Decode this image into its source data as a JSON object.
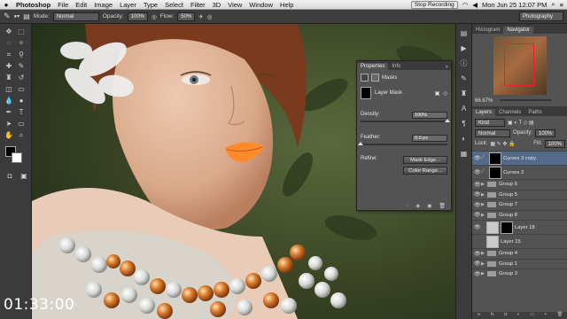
{
  "menubar": {
    "apple": "",
    "items": [
      "Photoshop",
      "File",
      "Edit",
      "Image",
      "Layer",
      "Type",
      "Select",
      "Filter",
      "3D",
      "View",
      "Window",
      "Help"
    ],
    "recording": "Stop Recording",
    "datetime": "Mon Jun 25  12:07 PM"
  },
  "options": {
    "mode_label": "Mode:",
    "mode_value": "Normal",
    "opacity_label": "Opacity:",
    "opacity_value": "100%",
    "flow_label": "Flow:",
    "flow_value": "50%",
    "workspace": "Photography"
  },
  "timecode": "01:33:00",
  "navigator": {
    "tabs": [
      "Histogram",
      "Navigator"
    ],
    "zoom": "66.67%"
  },
  "properties": {
    "tabs": [
      "Properties",
      "Info"
    ],
    "section": "Masks",
    "mask_label": "Layer Mask",
    "density_label": "Density:",
    "density_value": "100%",
    "feather_label": "Feather:",
    "feather_value": "0.0 px",
    "refine_label": "Refine:",
    "mask_edge_button": "Mask Edge...",
    "color_range_button": "Color Range..."
  },
  "layers_panel": {
    "tabs": [
      "Layers",
      "Channels",
      "Paths"
    ],
    "kind": "Kind",
    "blend": "Normal",
    "opacity_label": "Opacity:",
    "opacity_value": "100%",
    "lock_label": "Lock:",
    "fill_label": "Fill:",
    "fill_value": "100%",
    "layers": [
      {
        "name": "Curves 3 copy",
        "type": "adjust",
        "selected": true
      },
      {
        "name": "Curves 3",
        "type": "adjust",
        "selected": false
      },
      {
        "name": "Group 6",
        "type": "group",
        "selected": false
      },
      {
        "name": "Group 5",
        "type": "group",
        "selected": false
      },
      {
        "name": "Group 7",
        "type": "group",
        "selected": false
      },
      {
        "name": "Group 8",
        "type": "group",
        "selected": false
      },
      {
        "name": "Layer 18",
        "type": "pixel",
        "selected": false
      },
      {
        "name": "Layer 15",
        "type": "pixel",
        "selected": false
      },
      {
        "name": "Group 4",
        "type": "group",
        "selected": false
      },
      {
        "name": "Group 1",
        "type": "group",
        "selected": false
      },
      {
        "name": "Group 3",
        "type": "group",
        "selected": false
      }
    ]
  },
  "colors": {
    "fg": "#000000",
    "bg": "#ffffff",
    "lips": "#ff8a2a",
    "selected_layer": "#546a8a"
  }
}
